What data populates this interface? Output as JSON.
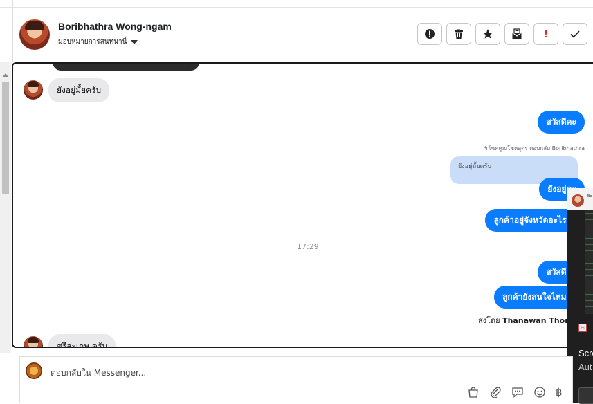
{
  "header": {
    "contact_name": "Boribhathra Wong-ngam",
    "assign_label": "มอบหมายการสนทนานี้",
    "action_icons": [
      "alert-circle-icon",
      "trash-icon",
      "star-icon",
      "mark-unread-icon",
      "important-icon",
      "check-icon"
    ],
    "important_label": "!"
  },
  "messages": {
    "in_1": "ยังอยู่มั้ยครับ",
    "out_1": "สวัสดีคะ",
    "reply_label": "โชคคูณโชคอุดร ตอบกลับ Boribhathra",
    "quoted_text": "ยังอยู่มั้ยครับ",
    "out_2": "ยังอยู่คะ",
    "out_3": "ลูกค้าอยู่จังหวัดอะไรคะ",
    "timestamp": "17:29",
    "out_4": "สวัสดีคะ",
    "out_5": "ลูกค้ายังสนใจไหมคะ",
    "sent_by_prefix": "ส่งโดย",
    "sent_by_name": "Thanawan Thon",
    "in_2": "ศรีสะเกษ ครับ"
  },
  "popup": {
    "title": "Scre",
    "subtitle": "Aut",
    "header_text": "Bo"
  },
  "composer": {
    "placeholder": "ตอบกลับใน Messenger...",
    "tool_icons": [
      "shopping-bag-icon",
      "paperclip-icon",
      "saved-reply-icon",
      "emoji-icon",
      "baht-icon"
    ],
    "baht_symbol": "฿"
  },
  "colors": {
    "outgoing_bubble": "#0a7cff",
    "incoming_bubble": "#e9e9eb",
    "quote_bubble": "#c9ddf8",
    "important": "#e0242b"
  }
}
